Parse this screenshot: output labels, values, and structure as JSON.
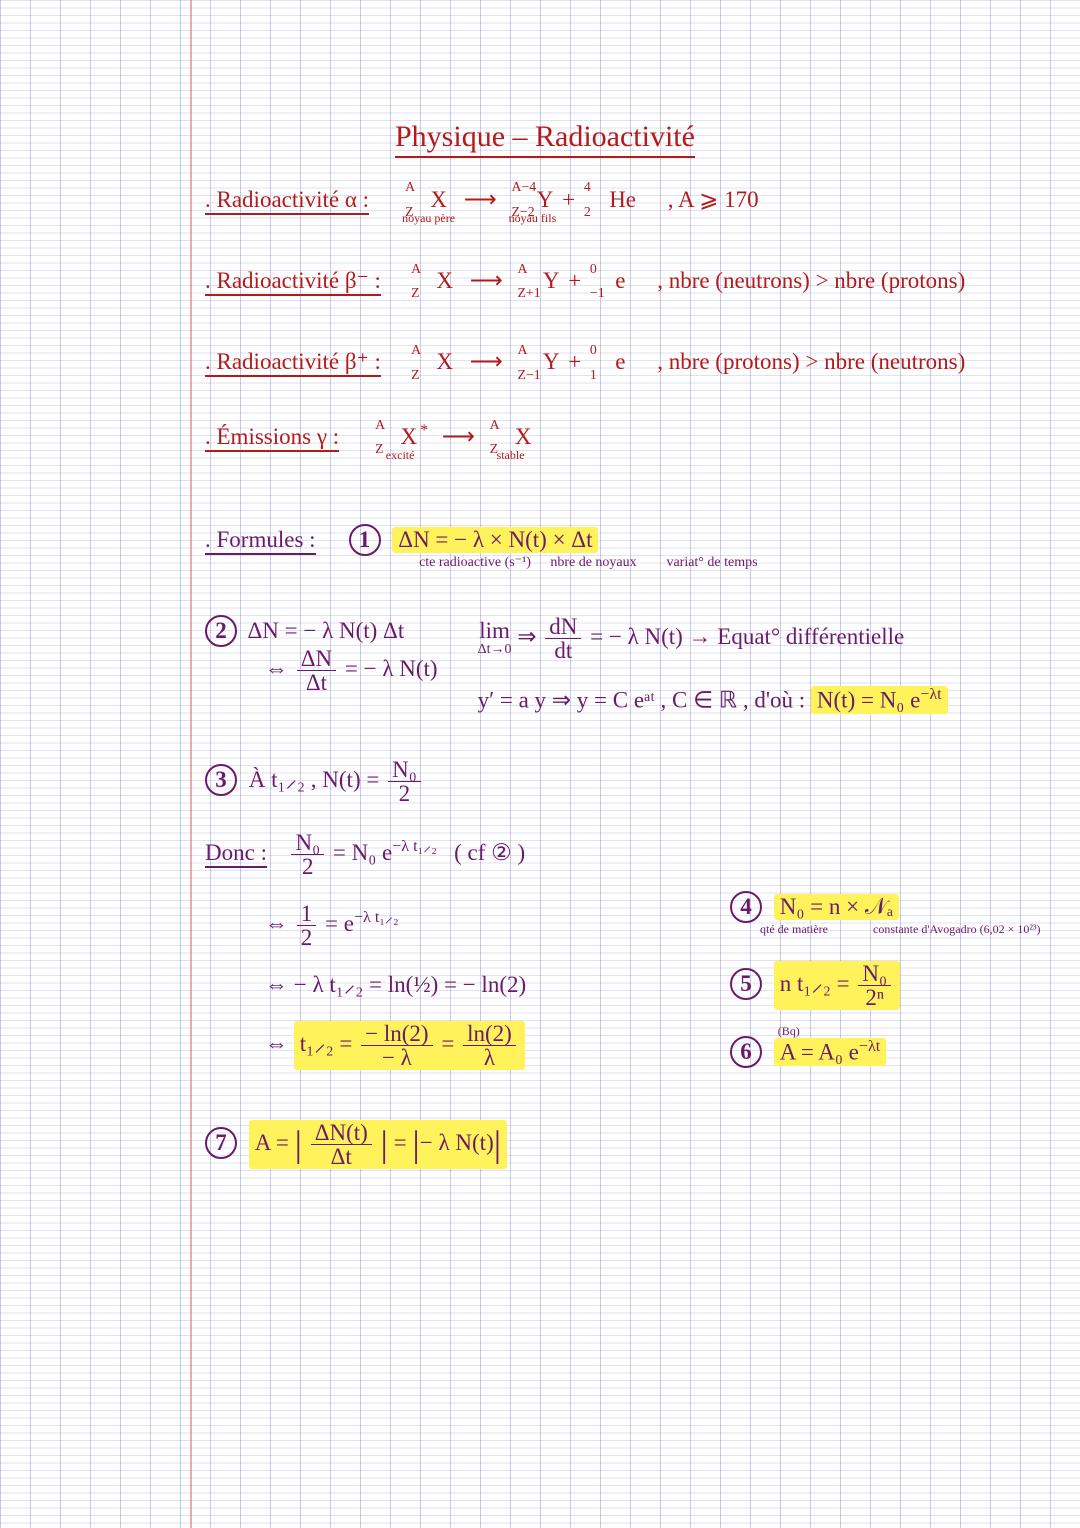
{
  "title": "Physique – Radioactivité",
  "sections": {
    "alpha": {
      "label": ". Radioactivité α :",
      "parent_top": "A",
      "parent_bot": "Z",
      "child_top": "A−4",
      "child_bot": "Z−2",
      "he_top": "4",
      "he_bot": "2",
      "note_parent": "noyau père",
      "note_child": "noyau fils",
      "cond": ", A ⩾ 170"
    },
    "beta_minus": {
      "label": ". Radioactivité β⁻ :",
      "parent_top": "A",
      "parent_bot": "Z",
      "child_top": "A",
      "child_bot": "Z+1",
      "e_top": "0",
      "e_bot": "−1",
      "cond": ", nbre (neutrons) > nbre (protons)"
    },
    "beta_plus": {
      "label": ". Radioactivité β⁺ :",
      "parent_top": "A",
      "parent_bot": "Z",
      "child_top": "A",
      "child_bot": "Z−1",
      "e_top": "0",
      "e_bot": "1",
      "cond": ", nbre (protons) > nbre (neutrons)"
    },
    "gamma": {
      "label": ". Émissions γ :",
      "parent_top": "A",
      "parent_bot": "Z",
      "child_top": "A",
      "child_bot": "Z",
      "note_parent": "excité",
      "note_child": "stable"
    }
  },
  "formules_label": ". Formules :",
  "f1": {
    "num": "1",
    "eq": "ΔN = − λ × N(t) × Δt",
    "ann_lambda": "cte radioactive (s⁻¹)",
    "ann_N": "nbre de noyaux",
    "ann_dt": "variat° de temps"
  },
  "f2": {
    "num": "2",
    "l1": "ΔN = − λ N(t) Δt",
    "l2a": "⇔",
    "l2_frac_n": "ΔN",
    "l2_frac_d": "Δt",
    "l2b": " = − λ N(t)",
    "lim_top": "lim",
    "lim_bot": "Δt→0",
    "lim_impl": "⇒",
    "dN_n": "dN",
    "dN_d": "dt",
    "lim_rhs": " = − λ N(t) → Equat° différentielle",
    "ode": "y′ = a y  ⇒  y = C eᵃᵗ , C ∈ ℝ , d'où :",
    "result": "N(t) = N₀ e⁻ˡᵗ",
    "result_plain": "N(t) = N₀ e",
    "result_exp": "−λt"
  },
  "f3": {
    "num": "3",
    "txt": "À t₁⸝₂ ,  N(t) =",
    "frac_n": "N₀",
    "frac_d": "2"
  },
  "donc_label": "Donc :",
  "donc": {
    "l1_lhs_n": "N₀",
    "l1_lhs_d": "2",
    "l1_mid": " = N₀ e",
    "l1_exp": "−λ t₁⸝₂",
    "l1_ref": "( cf ② )",
    "l2_pre": "⇔ ",
    "l2_lhs_n": "1",
    "l2_lhs_d": "2",
    "l2_mid": " = e",
    "l2_exp": "−λ t₁⸝₂",
    "l3": "⇔  − λ t₁⸝₂  =  ln(½)  =  − ln(2)",
    "l4_pre": "⇔  ",
    "l4_lhs": "t₁⸝₂ =",
    "l4_f1_n": "− ln(2)",
    "l4_f1_d": "− λ",
    "l4_eq": " = ",
    "l4_f2_n": "ln(2)",
    "l4_f2_d": "λ"
  },
  "f4": {
    "num": "4",
    "eq": "N₀ = n × 𝒩ₐ",
    "ann_n": "qté de matière",
    "ann_Na": "constante d'Avogadro (6,02 × 10²³)"
  },
  "f5": {
    "num": "5",
    "lhs": "n t₁⸝₂ =",
    "frac_n": "N₀",
    "frac_d": "2ⁿ"
  },
  "f6": {
    "num": "6",
    "unit": "(Bq)",
    "eq_plain": "A = A₀ e",
    "eq_exp": "−λt"
  },
  "f7": {
    "num": "7",
    "pre": "A =",
    "frac_n": "ΔN(t)",
    "frac_d": "Δt",
    "mid": " = ",
    "rhs": "− λ N(t)"
  },
  "sym": {
    "X": "X",
    "Y": "Y",
    "He": "He",
    "e": "e",
    "arrow": "⟶",
    "star": "*",
    "plus": " + "
  }
}
